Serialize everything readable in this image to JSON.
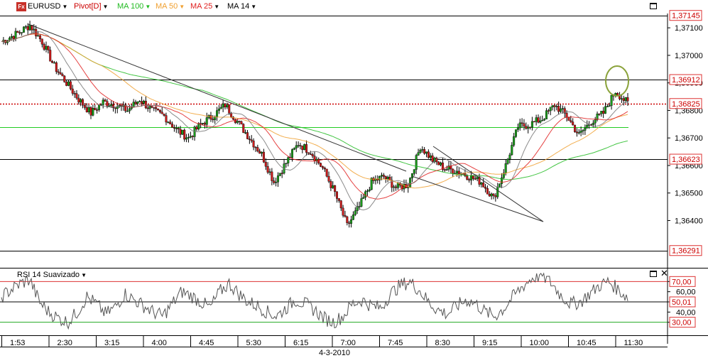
{
  "toolbar": {
    "logo": "Fx",
    "symbol": "EURUSD",
    "pivot": "Pivot[D]",
    "ma100": "MA 100",
    "ma50": "MA 50",
    "ma25": "MA 25",
    "ma14": "MA 14"
  },
  "rsi_panel": {
    "title": "RSI 14 Suavizado"
  },
  "date_label": "4-3-2010",
  "colors": {
    "ma100": "#22bb22",
    "ma50": "#f0a030",
    "ma25": "#e02020",
    "ma14": "#000000",
    "pivot": "#cc0000",
    "candle_up": "#1a9a1a",
    "candle_down": "#cc1a1a",
    "tag_border": "#dd3333"
  },
  "chart_data": [
    {
      "type": "candlestick",
      "instrument": "EURUSD",
      "x_ticks": [
        "1:53",
        "2:30",
        "3:15",
        "4:00",
        "4:45",
        "5:30",
        "6:15",
        "7:00",
        "7:45",
        "8:30",
        "9:15",
        "10:00",
        "10:45",
        "11:30"
      ],
      "price_ticks": [
        "1,37100",
        "1,37000",
        "1,36900",
        "1,36800",
        "1,36700",
        "1,36600",
        "1,36500",
        "1,36400"
      ],
      "ylim": [
        1.36291,
        1.37145
      ],
      "horizontal_levels": [
        {
          "label": "1,37145",
          "value": 1.37145
        },
        {
          "label": "1,36912",
          "value": 1.36912
        },
        {
          "label": "1,36825",
          "value": 1.36825
        },
        {
          "label": "1,36623",
          "value": 1.36623
        },
        {
          "label": "1,36291",
          "value": 1.36291
        }
      ],
      "extra_level": 1.3674,
      "pivot_level": 1.36825,
      "moving_averages": [
        "MA 100",
        "MA 50",
        "MA 25",
        "MA 14"
      ],
      "approx_close_path": [
        [
          0,
          1.3705
        ],
        [
          8,
          1.3708
        ],
        [
          14,
          1.3711
        ],
        [
          20,
          1.3705
        ],
        [
          26,
          1.3696
        ],
        [
          32,
          1.369
        ],
        [
          38,
          1.3684
        ],
        [
          44,
          1.3679
        ],
        [
          50,
          1.3683
        ],
        [
          56,
          1.3682
        ],
        [
          62,
          1.368
        ],
        [
          68,
          1.3684
        ],
        [
          74,
          1.368
        ],
        [
          80,
          1.3678
        ],
        [
          86,
          1.3673
        ],
        [
          92,
          1.367
        ],
        [
          98,
          1.3675
        ],
        [
          104,
          1.3678
        ],
        [
          110,
          1.3682
        ],
        [
          116,
          1.3676
        ],
        [
          122,
          1.367
        ],
        [
          128,
          1.3664
        ],
        [
          134,
          1.3654
        ],
        [
          140,
          1.3661
        ],
        [
          146,
          1.3668
        ],
        [
          152,
          1.3665
        ],
        [
          158,
          1.3659
        ],
        [
          164,
          1.365
        ],
        [
          170,
          1.3638
        ],
        [
          176,
          1.3645
        ],
        [
          182,
          1.3654
        ],
        [
          188,
          1.3656
        ],
        [
          194,
          1.3652
        ],
        [
          200,
          1.3653
        ],
        [
          206,
          1.3667
        ],
        [
          212,
          1.3662
        ],
        [
          218,
          1.3659
        ],
        [
          224,
          1.3658
        ],
        [
          230,
          1.3656
        ],
        [
          236,
          1.3654
        ],
        [
          242,
          1.3648
        ],
        [
          248,
          1.366
        ],
        [
          254,
          1.3674
        ],
        [
          260,
          1.3675
        ],
        [
          266,
          1.3677
        ],
        [
          272,
          1.3682
        ],
        [
          278,
          1.3678
        ],
        [
          284,
          1.3671
        ],
        [
          290,
          1.3676
        ],
        [
          296,
          1.3679
        ],
        [
          302,
          1.3687
        ],
        [
          308,
          1.36825
        ]
      ]
    },
    {
      "type": "line",
      "name": "RSI 14 Suavizado",
      "ylim": [
        20,
        80
      ],
      "ticks": [
        "70,00",
        "60,00",
        "50,01",
        "40,00",
        "30,00"
      ],
      "levels": [
        70,
        50.01,
        30
      ],
      "approx_values": [
        55,
        62,
        68,
        72,
        50,
        40,
        34,
        30,
        40,
        55,
        48,
        38,
        45,
        58,
        52,
        46,
        40,
        36,
        48,
        60,
        56,
        50,
        44,
        60,
        68,
        58,
        50,
        46,
        40,
        36,
        44,
        52,
        48,
        42,
        34,
        30,
        36,
        48,
        52,
        46,
        44,
        58,
        66,
        70,
        62,
        50,
        42,
        38,
        46,
        52,
        48,
        40,
        36,
        44,
        56,
        66,
        74,
        76,
        68,
        56,
        48,
        50,
        58,
        66,
        70,
        62,
        54
      ]
    }
  ]
}
